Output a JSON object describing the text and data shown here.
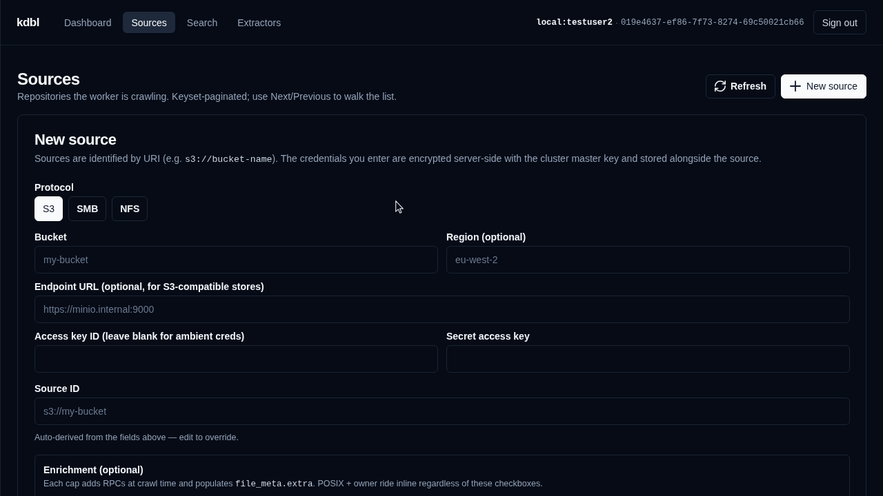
{
  "app": {
    "logo": "kdbl"
  },
  "nav": {
    "items": [
      {
        "label": "Dashboard",
        "selected": false
      },
      {
        "label": "Sources",
        "selected": true
      },
      {
        "label": "Search",
        "selected": false
      },
      {
        "label": "Extractors",
        "selected": false
      }
    ]
  },
  "account": {
    "user": "local:testuser2",
    "separator": "·",
    "session_id": "019e4637-ef86-7f73-8274-69c50021cb66",
    "sign_out": "Sign out"
  },
  "page": {
    "title": "Sources",
    "subtitle": "Repositories the worker is crawling. Keyset-paginated; use Next/Previous to walk the list.",
    "actions": [
      {
        "kind": "refresh",
        "label": "Refresh"
      },
      {
        "kind": "new",
        "label": "New source"
      }
    ]
  },
  "form": {
    "title": "New source",
    "description": [
      {
        "kind": "text",
        "text": "Sources are identified by URI (e.g. "
      },
      {
        "kind": "code",
        "text": "s3://bucket-name"
      },
      {
        "kind": "text",
        "text": "). The credentials you enter are encrypted server-side with the cluster master key and stored alongside the source."
      }
    ],
    "protocol": {
      "label": "Protocol",
      "options": [
        {
          "label": "S3",
          "selected": true
        },
        {
          "label": "SMB",
          "selected": false
        },
        {
          "label": "NFS",
          "selected": false
        }
      ]
    },
    "rows": [
      {
        "fields": [
          {
            "label": "Bucket",
            "placeholder": "my-bucket"
          },
          {
            "label": "Region (optional)",
            "placeholder": "eu-west-2"
          }
        ]
      },
      {
        "fields": [
          {
            "label": "Endpoint URL (optional, for S3-compatible stores)",
            "placeholder": "https://minio.internal:9000"
          }
        ]
      },
      {
        "fields": [
          {
            "label": "Access key ID (leave blank for ambient creds)"
          },
          {
            "label": "Secret access key"
          }
        ]
      },
      {
        "fields": [
          {
            "label": "Source ID",
            "placeholder": "s3://my-bucket",
            "hint": "Auto-derived from the fields above — edit to override."
          }
        ]
      }
    ],
    "enrichment": {
      "title": "Enrichment (optional)",
      "description": [
        {
          "kind": "text",
          "text": "Each cap adds RPCs at crawl time and populates "
        },
        {
          "kind": "code",
          "text": "file_meta.extra"
        },
        {
          "kind": "text",
          "text": ". POSIX + owner ride inline regardless of these checkboxes."
        }
      ]
    }
  }
}
